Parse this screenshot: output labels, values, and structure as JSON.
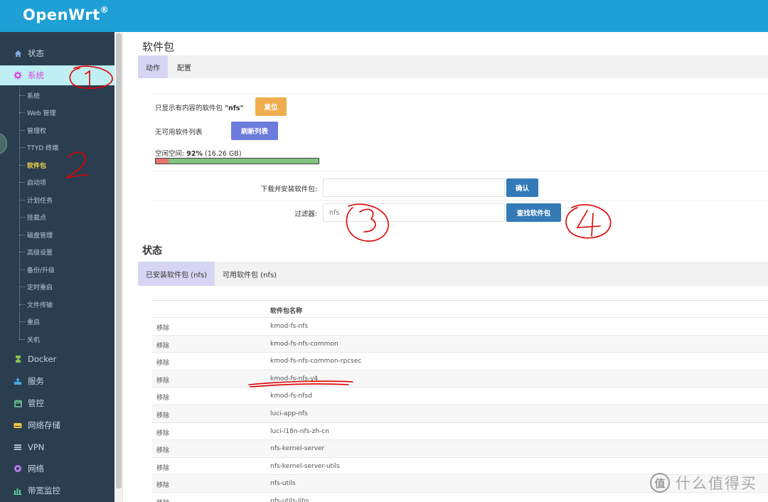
{
  "header": {
    "brand": "OpenWrt",
    "brand_mark": "®"
  },
  "sidebar": {
    "items": [
      {
        "label": "状态",
        "icon": "home-icon"
      },
      {
        "label": "系统",
        "icon": "gear-icon",
        "active": true
      },
      {
        "label": "Docker",
        "icon": "docker-icon"
      },
      {
        "label": "服务",
        "icon": "service-icon"
      },
      {
        "label": "管控",
        "icon": "calendar-icon"
      },
      {
        "label": "网络存储",
        "icon": "storage-icon"
      },
      {
        "label": "VPN",
        "icon": "vpn-icon"
      },
      {
        "label": "网络",
        "icon": "network-icon"
      },
      {
        "label": "带宽监控",
        "icon": "chart-icon"
      }
    ],
    "sub_items": [
      {
        "label": "系统"
      },
      {
        "label": "Web 管理"
      },
      {
        "label": "管理权"
      },
      {
        "label": "TTYD 终端"
      },
      {
        "label": "软件包",
        "active": true
      },
      {
        "label": "启动项"
      },
      {
        "label": "计划任务"
      },
      {
        "label": "挂载点"
      },
      {
        "label": "磁盘管理"
      },
      {
        "label": "高级设置"
      },
      {
        "label": "备份/升级"
      },
      {
        "label": "定时重启"
      },
      {
        "label": "文件传输"
      },
      {
        "label": "重启"
      },
      {
        "label": "关机"
      }
    ]
  },
  "main": {
    "title": "软件包",
    "tabs": [
      {
        "label": "动作"
      },
      {
        "label": "配置"
      }
    ],
    "filter_notice_prefix": "只显示有内容的软件包",
    "filter_notice_value": "\"nfs\"",
    "reset_label": "复位",
    "no_list_text": "无可用软件列表",
    "refresh_label": "刷新列表",
    "free_space_label": "空闲空间:",
    "free_space_value": "92%",
    "free_space_size": "(16.26 GB)",
    "free_space_fraction": 0.92,
    "download_label": "下载并安装软件包:",
    "download_value": "",
    "confirm_label": "确认",
    "filter_label": "过滤器:",
    "filter_value": "nfs",
    "find_label": "查找软件包"
  },
  "status": {
    "title": "状态",
    "tabs": [
      {
        "label": "已安装软件包 (nfs)"
      },
      {
        "label": "可用软件包 (nfs)"
      }
    ],
    "table": {
      "header": "软件包名称",
      "action_label": "移除",
      "rows": [
        "kmod-fs-nfs",
        "kmod-fs-nfs-common",
        "kmod-fs-nfs-common-rpcsec",
        "kmod-fs-nfs-v4",
        "kmod-fs-nfsd",
        "luci-app-nfs",
        "luci-i18n-nfs-zh-cn",
        "nfs-kernel-server",
        "nfs-kernel-server-utils",
        "nfs-utils",
        "nfs-utils-libs"
      ]
    }
  },
  "watermark": {
    "logo": "值",
    "text": "什么值得买"
  },
  "colors": {
    "header": "#1e9fd6",
    "sidebar": "#2b3e50",
    "active_menu": "#bfeff2",
    "active_sub": "#f4d341",
    "reset_button": "#f0ad4e",
    "refresh_button": "#6c7cdc",
    "primary_button": "#337ab7",
    "annotation": "#e00000"
  }
}
